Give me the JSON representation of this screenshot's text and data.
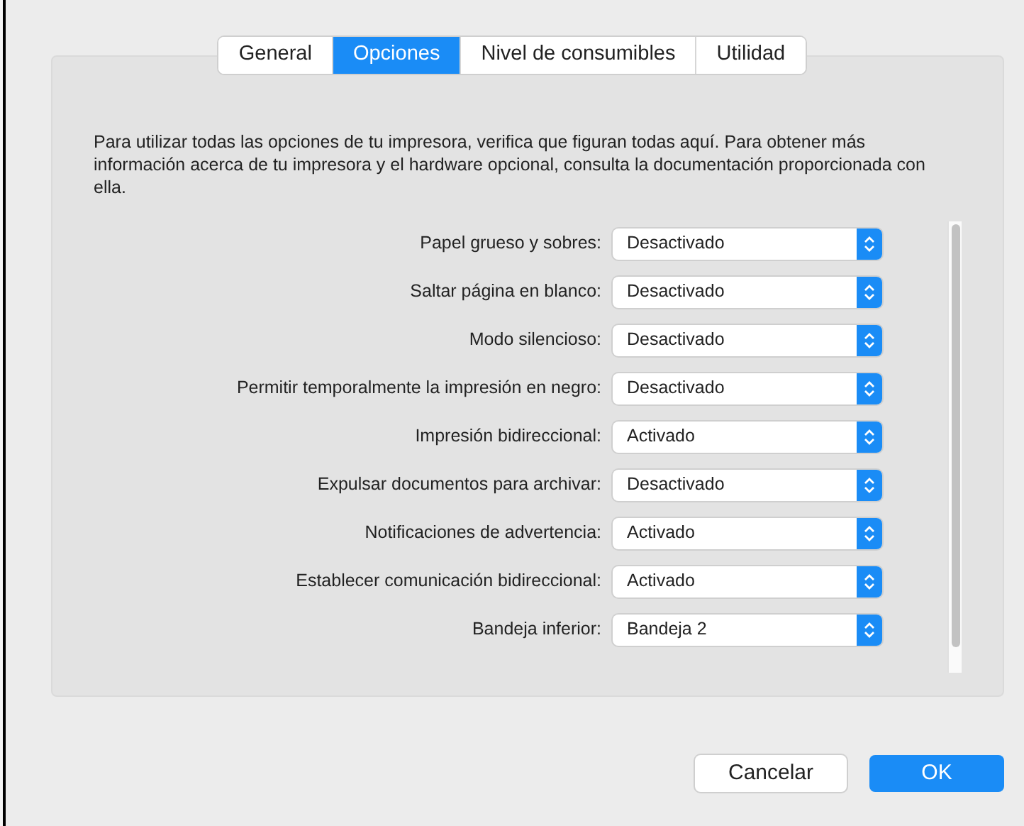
{
  "tabs": [
    {
      "label": "General",
      "selected": false
    },
    {
      "label": "Opciones",
      "selected": true
    },
    {
      "label": "Nivel de consumibles",
      "selected": false
    },
    {
      "label": "Utilidad",
      "selected": false
    }
  ],
  "description": "Para utilizar todas las opciones de tu impresora, verifica que figuran todas aquí. Para obtener más información acerca de tu impresora y el hardware opcional, consulta la documentación proporcionada con ella.",
  "options": [
    {
      "label": "Papel grueso y sobres:",
      "value": "Desactivado"
    },
    {
      "label": "Saltar página en blanco:",
      "value": "Desactivado"
    },
    {
      "label": "Modo silencioso:",
      "value": "Desactivado"
    },
    {
      "label": "Permitir temporalmente la impresión en negro:",
      "value": "Desactivado"
    },
    {
      "label": "Impresión bidireccional:",
      "value": "Activado"
    },
    {
      "label": "Expulsar documentos para archivar:",
      "value": "Desactivado"
    },
    {
      "label": "Notificaciones de advertencia:",
      "value": "Activado"
    },
    {
      "label": "Establecer comunicación bidireccional:",
      "value": "Activado"
    },
    {
      "label": "Bandeja inferior:",
      "value": "Bandeja 2"
    }
  ],
  "buttons": [
    {
      "label": "Cancelar",
      "kind": "secondary"
    },
    {
      "label": "OK",
      "kind": "primary"
    }
  ]
}
